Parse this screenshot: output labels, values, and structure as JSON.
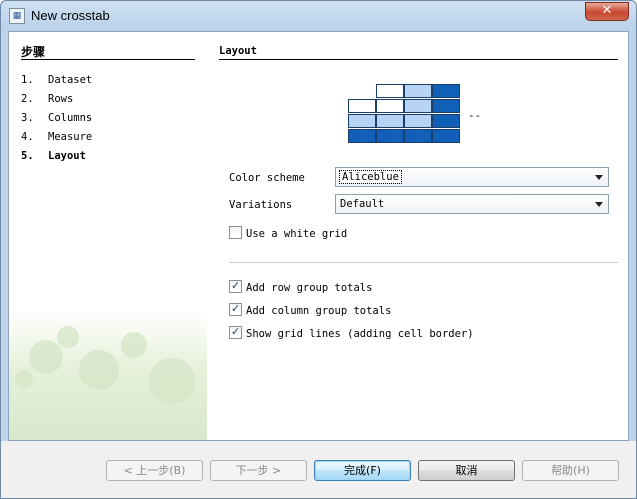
{
  "window": {
    "title": "New crosstab",
    "close_glyph": "✕"
  },
  "steps": {
    "heading": "步骤",
    "items": [
      {
        "num": "1.",
        "label": "Dataset"
      },
      {
        "num": "2.",
        "label": "Rows"
      },
      {
        "num": "3.",
        "label": "Columns"
      },
      {
        "num": "4.",
        "label": "Measure"
      },
      {
        "num": "5.",
        "label": "Layout"
      }
    ],
    "current_index": 4
  },
  "layout": {
    "title": "Layout",
    "preview_suffix": "--",
    "color_scheme": {
      "label": "Color scheme",
      "value": "Aliceblue"
    },
    "variations": {
      "label": "Variations",
      "value": "Default"
    },
    "white_grid": {
      "label": "Use a white grid",
      "checked": false
    },
    "row_totals": {
      "label": "Add row group totals",
      "checked": true
    },
    "column_totals": {
      "label": "Add column group totals",
      "checked": true
    },
    "grid_lines": {
      "label": "Show grid lines (adding cell border)",
      "checked": true
    }
  },
  "buttons": {
    "back": "< 上一步(B)",
    "next": "下一步 >",
    "finish": "完成(F)",
    "cancel": "取消",
    "help": "帮助(H)"
  },
  "colors": {
    "preview_white": "#ffffff",
    "preview_light": "#b8d4f4",
    "preview_dark": "#1060b8"
  }
}
